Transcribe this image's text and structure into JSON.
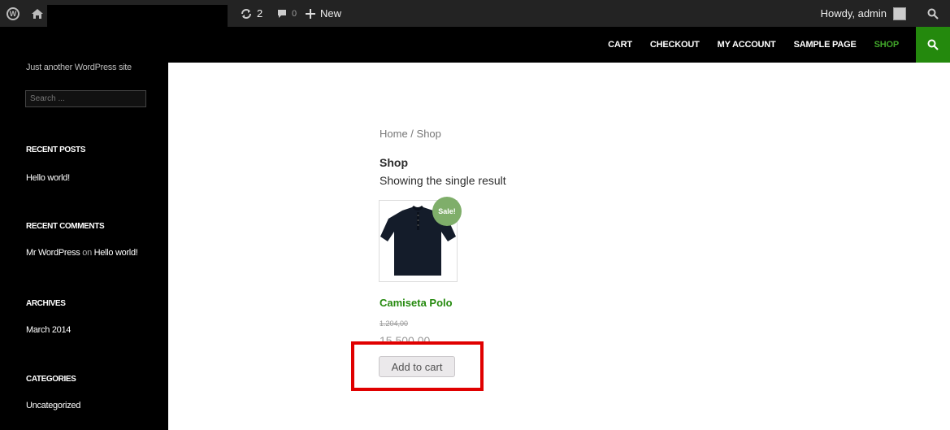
{
  "admin_bar": {
    "updates_count": "2",
    "comments_count": "0",
    "new_label": "New",
    "howdy_label": "Howdy, admin",
    "icons": [
      "wordpress-icon",
      "home-icon",
      "updates-icon",
      "comment-icon",
      "plus-icon",
      "search-icon"
    ]
  },
  "nav": {
    "items": [
      {
        "label": "CART",
        "active": false
      },
      {
        "label": "CHECKOUT",
        "active": false
      },
      {
        "label": "MY ACCOUNT",
        "active": false
      },
      {
        "label": "SAMPLE PAGE",
        "active": false
      },
      {
        "label": "SHOP",
        "active": true
      }
    ],
    "active_color": "#41a62a",
    "search_button_color": "#24890d"
  },
  "sidebar": {
    "tagline": "Just another WordPress site",
    "search_placeholder": "Search ...",
    "widgets": {
      "recent_posts": {
        "title": "RECENT POSTS",
        "items": [
          "Hello world!"
        ]
      },
      "recent_comments": {
        "title": "RECENT COMMENTS",
        "author": "Mr WordPress",
        "on_word": "on",
        "post": "Hello world!"
      },
      "archives": {
        "title": "ARCHIVES",
        "items": [
          "March 2014"
        ]
      },
      "categories": {
        "title": "CATEGORIES",
        "items": [
          "Uncategorized"
        ]
      }
    }
  },
  "main": {
    "breadcrumb": {
      "home": "Home",
      "separator": " / ",
      "current": "Shop"
    },
    "page_title": "Shop",
    "result_count": "Showing the single result",
    "product": {
      "sale_badge": "Sale!",
      "title": "Camiseta Polo",
      "old_price": "1.204,00",
      "price": "15.500,00",
      "add_to_cart_label": "Add to cart",
      "title_color": "#24890d"
    },
    "highlight_color": "#e00000"
  }
}
